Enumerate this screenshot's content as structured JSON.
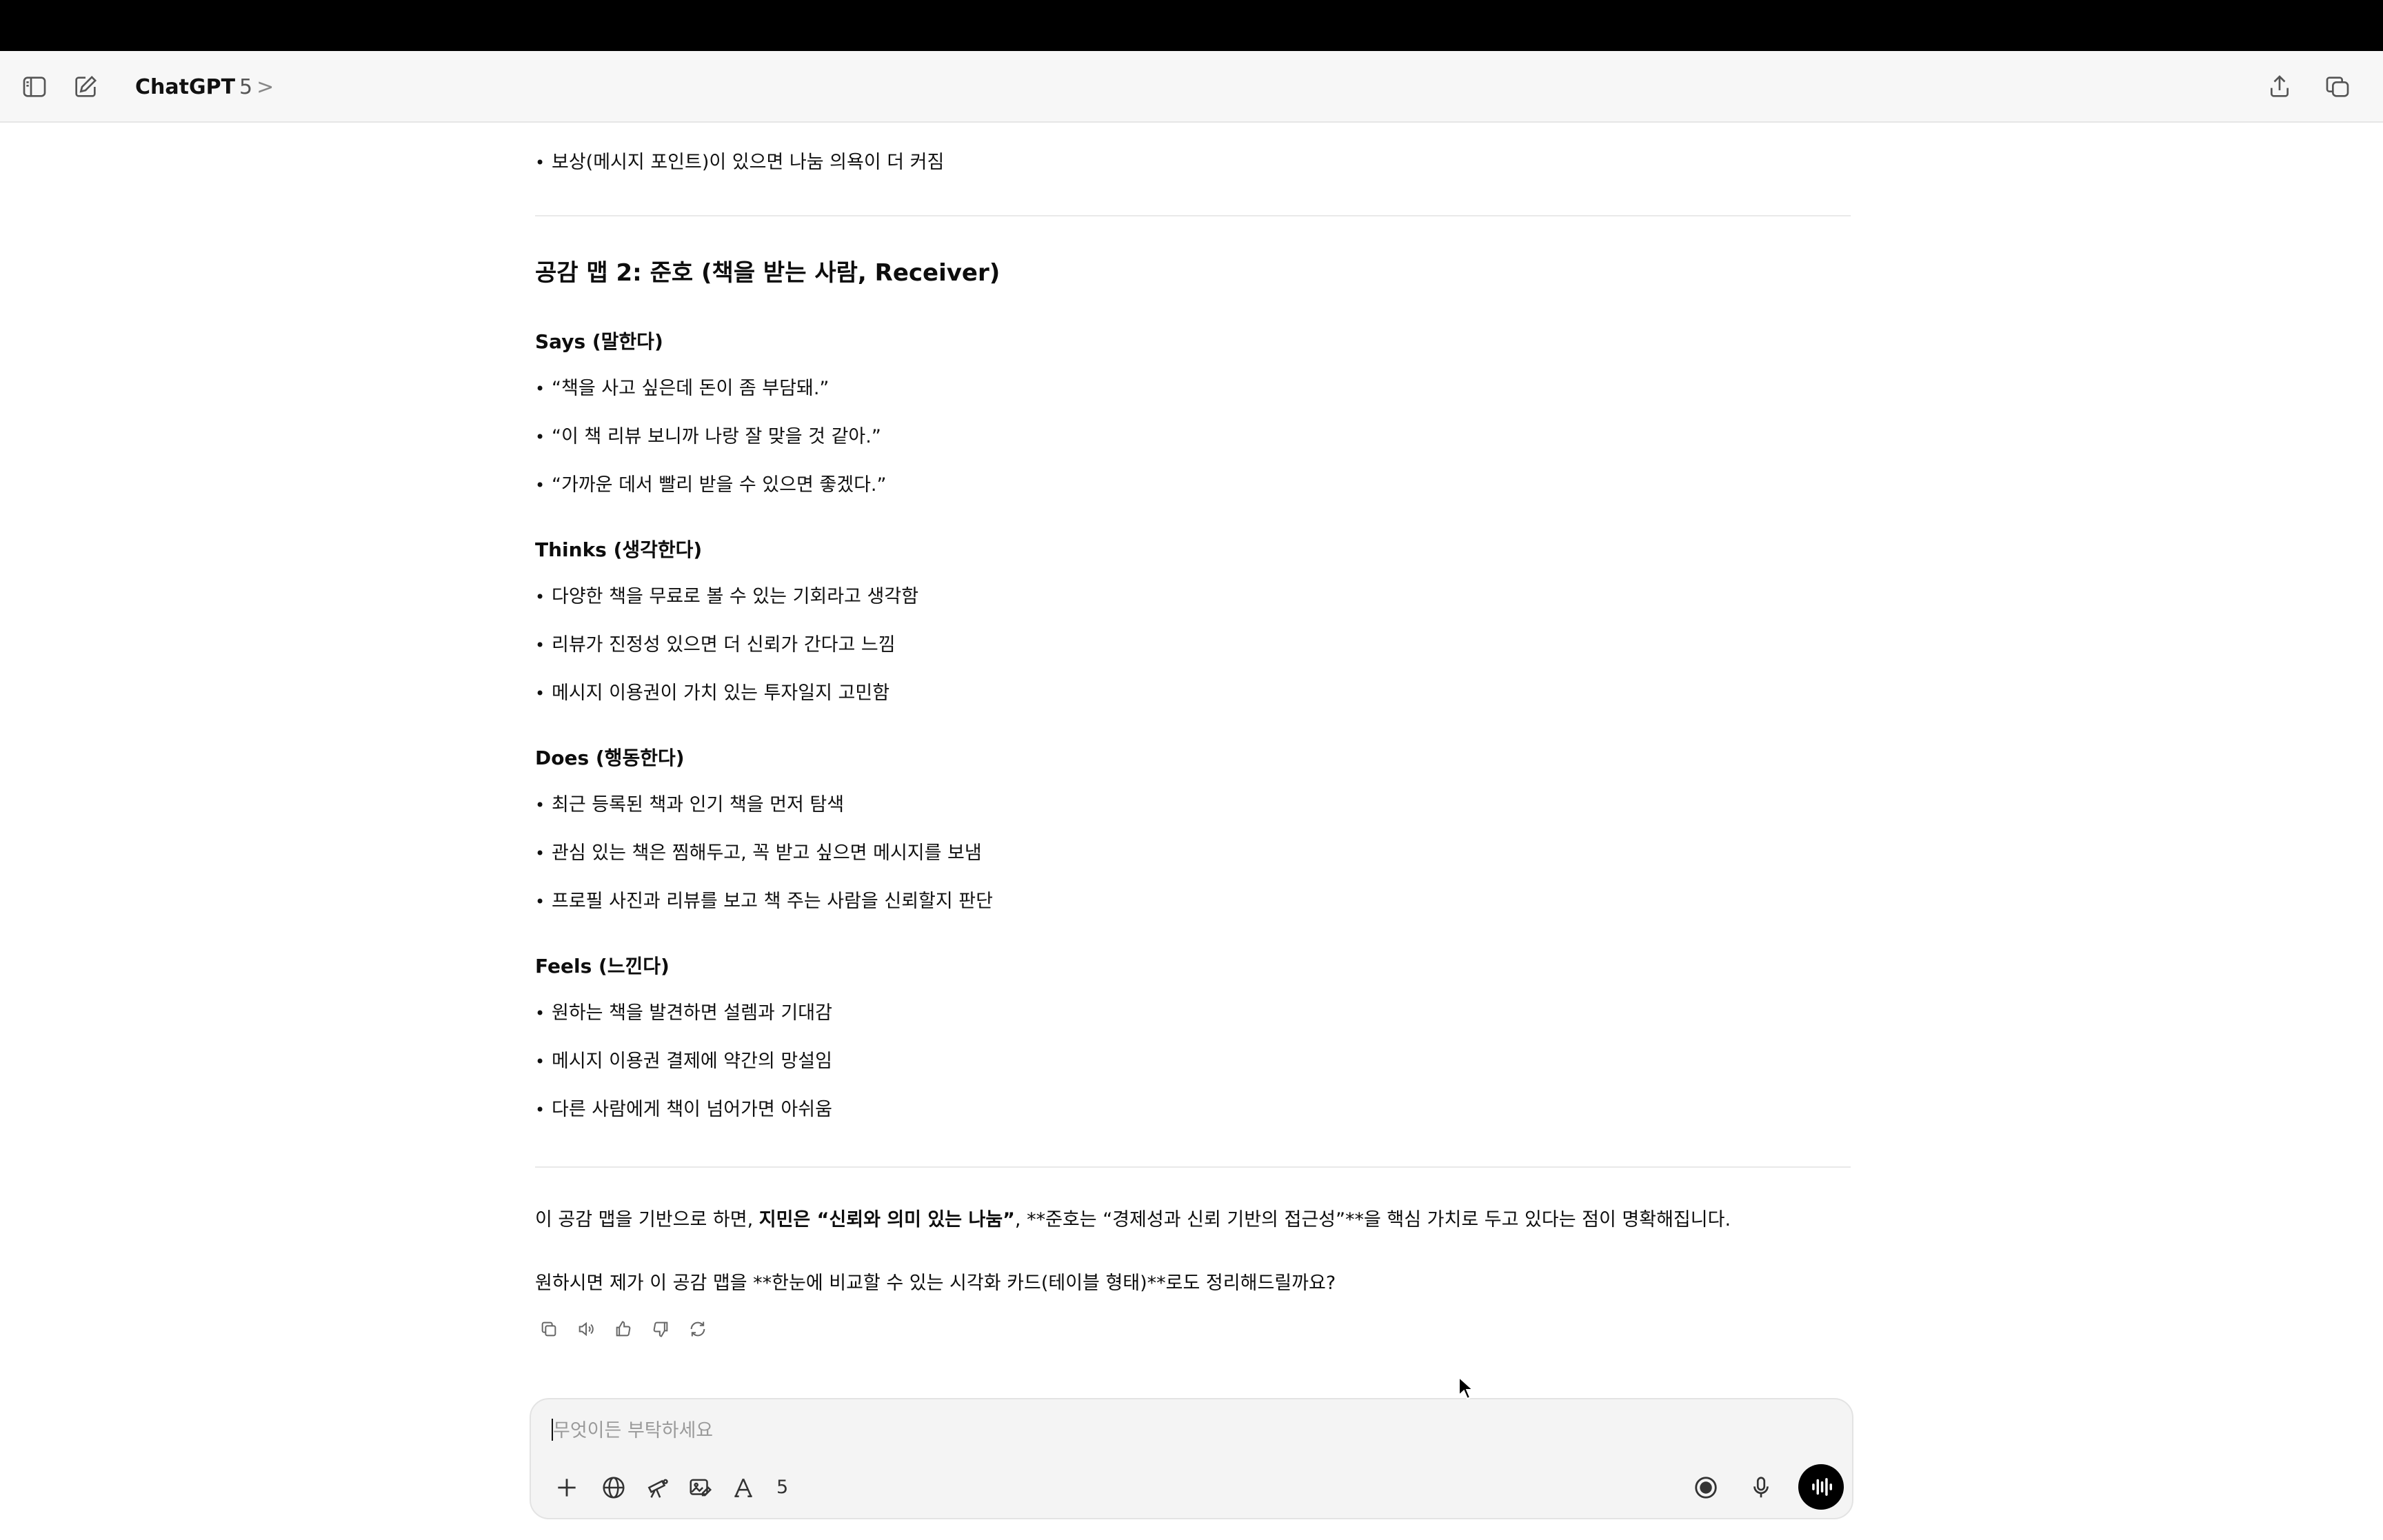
{
  "app": {
    "model_name": "ChatGPT",
    "model_version": "5",
    "chevron": ">"
  },
  "titlebar": {
    "sidebar_icon": "sidebar-toggle-icon",
    "new_chat_icon": "compose-icon",
    "share_icon": "share-icon",
    "window_icon": "new-window-icon"
  },
  "conversation": {
    "top_bullet": "보상(메시지 포인트)이 있으면 나눔 의욕이 더 커짐",
    "map2_title": "공감 맵 2: 준호 (책을 받는 사람, Receiver)",
    "sections": [
      {
        "heading": "Says (말한다)",
        "items": [
          "“책을 사고 싶은데 돈이 좀 부담돼.”",
          "“이 책 리뷰 보니까 나랑 잘 맞을 것 같아.”",
          "“가까운 데서 빨리 받을 수 있으면 좋겠다.”"
        ]
      },
      {
        "heading": "Thinks (생각한다)",
        "items": [
          "다양한 책을 무료로 볼 수 있는 기회라고 생각함",
          "리뷰가 진정성 있으면 더 신뢰가 간다고 느낌",
          "메시지 이용권이 가치 있는 투자일지 고민함"
        ]
      },
      {
        "heading": "Does (행동한다)",
        "items": [
          "최근 등록된 책과 인기 책을 먼저 탐색",
          "관심 있는 책은 찜해두고, 꼭 받고 싶으면 메시지를 보냄",
          "프로필 사진과 리뷰를 보고 책 주는 사람을 신뢰할지 판단"
        ]
      },
      {
        "heading": "Feels (느낀다)",
        "items": [
          "원하는 책을 발견하면 설렘과 기대감",
          "메시지 이용권 결제에 약간의 망설임",
          "다른 사람에게 책이 넘어가면 아쉬움"
        ]
      }
    ],
    "summary": {
      "part1": "이 공감 맵을 기반으로 하면, ",
      "bold": "지민은 “신뢰와 의미 있는 나눔”",
      "part2": ", **준호는 “경제성과 신뢰 기반의 접근성”**을 핵심 가치로 두고 있다는 점이 명확해집니다."
    },
    "followup": "원하시면 제가 이 공감 맵을 **한눈에 비교할 수 있는 시각화 카드(테이블 형태)**로도 정리해드릴까요?"
  },
  "message_actions": [
    "copy-icon",
    "read-aloud-icon",
    "thumbs-up-icon",
    "thumbs-down-icon",
    "regenerate-icon"
  ],
  "composer": {
    "placeholder": "무엇이든 부탁하세요",
    "tool_count": "5",
    "tools": [
      "plus-icon",
      "globe-icon",
      "telescope-icon",
      "image-edit-icon",
      "tools-icon"
    ],
    "right_tools": [
      "record-icon",
      "microphone-icon",
      "voice-mode-icon"
    ]
  }
}
